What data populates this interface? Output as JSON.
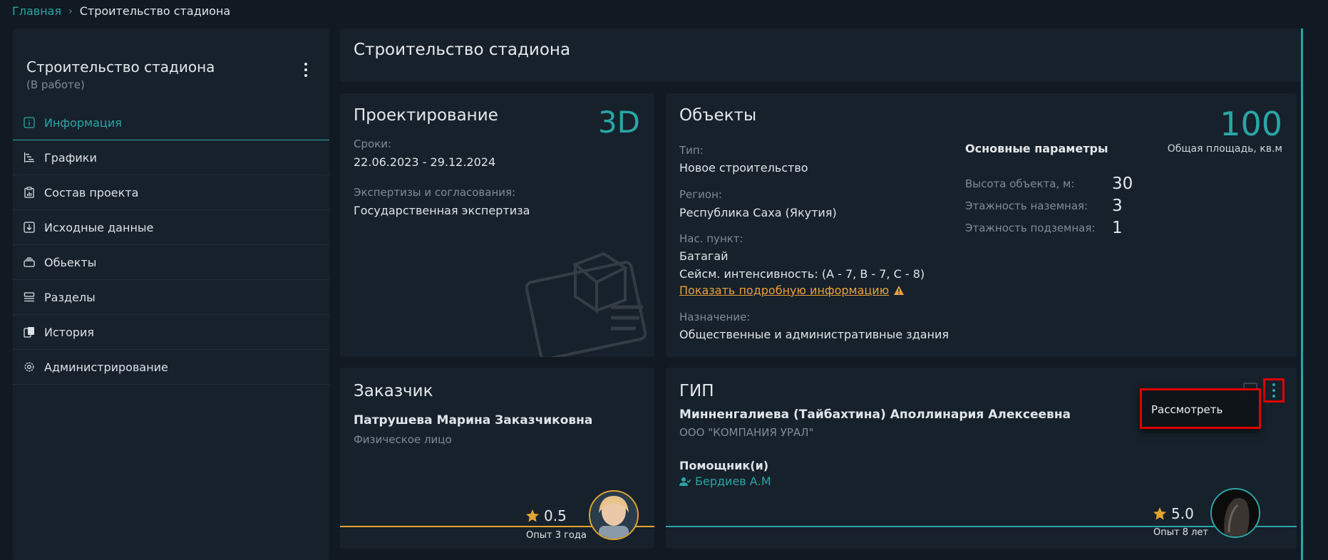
{
  "breadcrumb": {
    "home": "Главная",
    "separator": "›",
    "current": "Строительство стадиона"
  },
  "sidebar": {
    "title": "Строительство стадиона",
    "status": "(В работе)",
    "items": [
      {
        "label": "Информация",
        "icon": "info-icon",
        "active": true
      },
      {
        "label": "Графики",
        "icon": "gantt-icon"
      },
      {
        "label": "Состав проекта",
        "icon": "clipboard-chart-icon"
      },
      {
        "label": "Исходные данные",
        "icon": "download-box-icon"
      },
      {
        "label": "Обьекты",
        "icon": "layers-icon"
      },
      {
        "label": "Разделы",
        "icon": "sections-icon"
      },
      {
        "label": "История",
        "icon": "history-icon"
      },
      {
        "label": "Администрирование",
        "icon": "gear-icon"
      }
    ]
  },
  "header": {
    "title": "Строительство стадиона"
  },
  "design": {
    "title": "Проектирование",
    "badge": "3D",
    "terms_label": "Сроки:",
    "terms_value": "22.06.2023 - 29.12.2024",
    "expertise_label": "Экспертизы и согласования:",
    "expertise_value": "Государственная экспертиза"
  },
  "objects": {
    "title": "Объекты",
    "area_value": "100",
    "area_label": "Общая площадь, кв.м",
    "type_label": "Тип:",
    "type_value": "Новое строительство",
    "region_label": "Регион:",
    "region_value": "Республика Саха (Якутия)",
    "settlement_label": "Нас. пункт:",
    "settlement_value": "Батагай",
    "seismic": "Сейсм. интенсивность: (A - 7, B - 7, C - 8)",
    "details_link": "Показать подробную информацию",
    "purpose_label": "Назначение:",
    "purpose_value": "Общественные и административные здания",
    "params_title": "Основные параметры",
    "params": [
      {
        "label": "Высота объекта, м:",
        "value": "30"
      },
      {
        "label": "Этажность наземная:",
        "value": "3"
      },
      {
        "label": "Этажность подземная:",
        "value": "1"
      }
    ]
  },
  "customer": {
    "title": "Заказчик",
    "name": "Патрушева Марина Заказчиковна",
    "type": "Физическое лицо",
    "rating": "0.5",
    "experience": "Опыт 3 года",
    "accent": "#e3a532"
  },
  "gip": {
    "title": "ГИП",
    "name": "Минненгалиева (Тайбахтина) Аполлинария Алексеевна",
    "company": "ООО \"КОМПАНИЯ УРАЛ\"",
    "assistants_title": "Помощник(и)",
    "assistant": "Бердиев А.М",
    "rating": "5.0",
    "experience": "Опыт 8 лет",
    "accent": "#2aa6a6",
    "context_menu": {
      "item": "Рассмотреть"
    }
  }
}
